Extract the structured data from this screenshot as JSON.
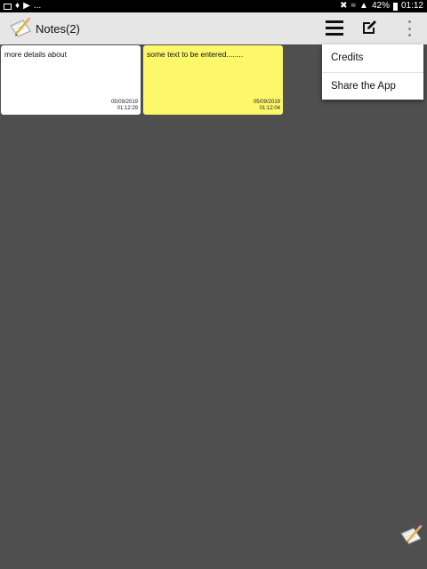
{
  "status_bar": {
    "dots": "...",
    "battery": "42%",
    "time": "01:12"
  },
  "app_bar": {
    "title": "Notes(2)"
  },
  "notes": [
    {
      "text": "more details about",
      "date": "05/09/2019",
      "time": "01:12:29",
      "color": "#ffffff"
    },
    {
      "text": "some text to be entered........",
      "date": "05/09/2019",
      "time": "01:12:04",
      "color": "#fdf76a"
    }
  ],
  "menu": {
    "items": [
      {
        "label": "Credits"
      },
      {
        "label": "Share the App"
      }
    ]
  },
  "colors": {
    "background": "#4f4f4f",
    "app_bar": "#e6e6e6",
    "note_yellow": "#fdf76a"
  },
  "icons": {
    "app_logo": "notepad-pencil-icon",
    "menu": "hamburger-icon",
    "edit": "edit-icon",
    "overflow": "more-vert-icon",
    "fab": "new-note-icon"
  }
}
